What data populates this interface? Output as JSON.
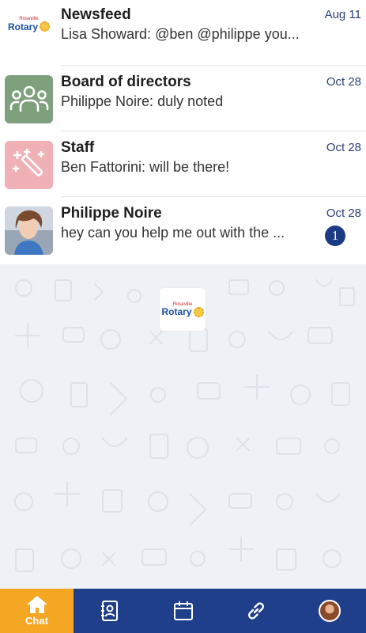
{
  "conversations": [
    {
      "title": "Newsfeed",
      "preview": "Lisa Showard: @ben @philippe you...",
      "date": "Aug 11",
      "avatar_icon": "rotary-logo-icon",
      "unread": null
    },
    {
      "title": "Board of directors",
      "preview": "Philippe Noire: duly noted",
      "date": "Oct 28",
      "avatar_icon": "group-icon",
      "avatar_color": "#7fa07d",
      "unread": null
    },
    {
      "title": "Staff",
      "preview": "Ben Fattorini: will be there!",
      "date": "Oct 28",
      "avatar_icon": "magic-wand-icon",
      "avatar_color": "#efb0b6",
      "unread": null
    },
    {
      "title": "Philippe Noire",
      "preview": "hey can you help me out with the ...",
      "date": "Oct 28",
      "avatar_icon": "user-photo",
      "unread": "1"
    }
  ],
  "logo": {
    "small": "Roseville",
    "big": "Rotary"
  },
  "tabbar": {
    "chat_label": "Chat",
    "active_color": "#f5a623",
    "bar_color": "#1f3f8a",
    "tabs": [
      "home-icon",
      "contacts-icon",
      "calendar-icon",
      "link-icon",
      "profile-avatar"
    ]
  }
}
